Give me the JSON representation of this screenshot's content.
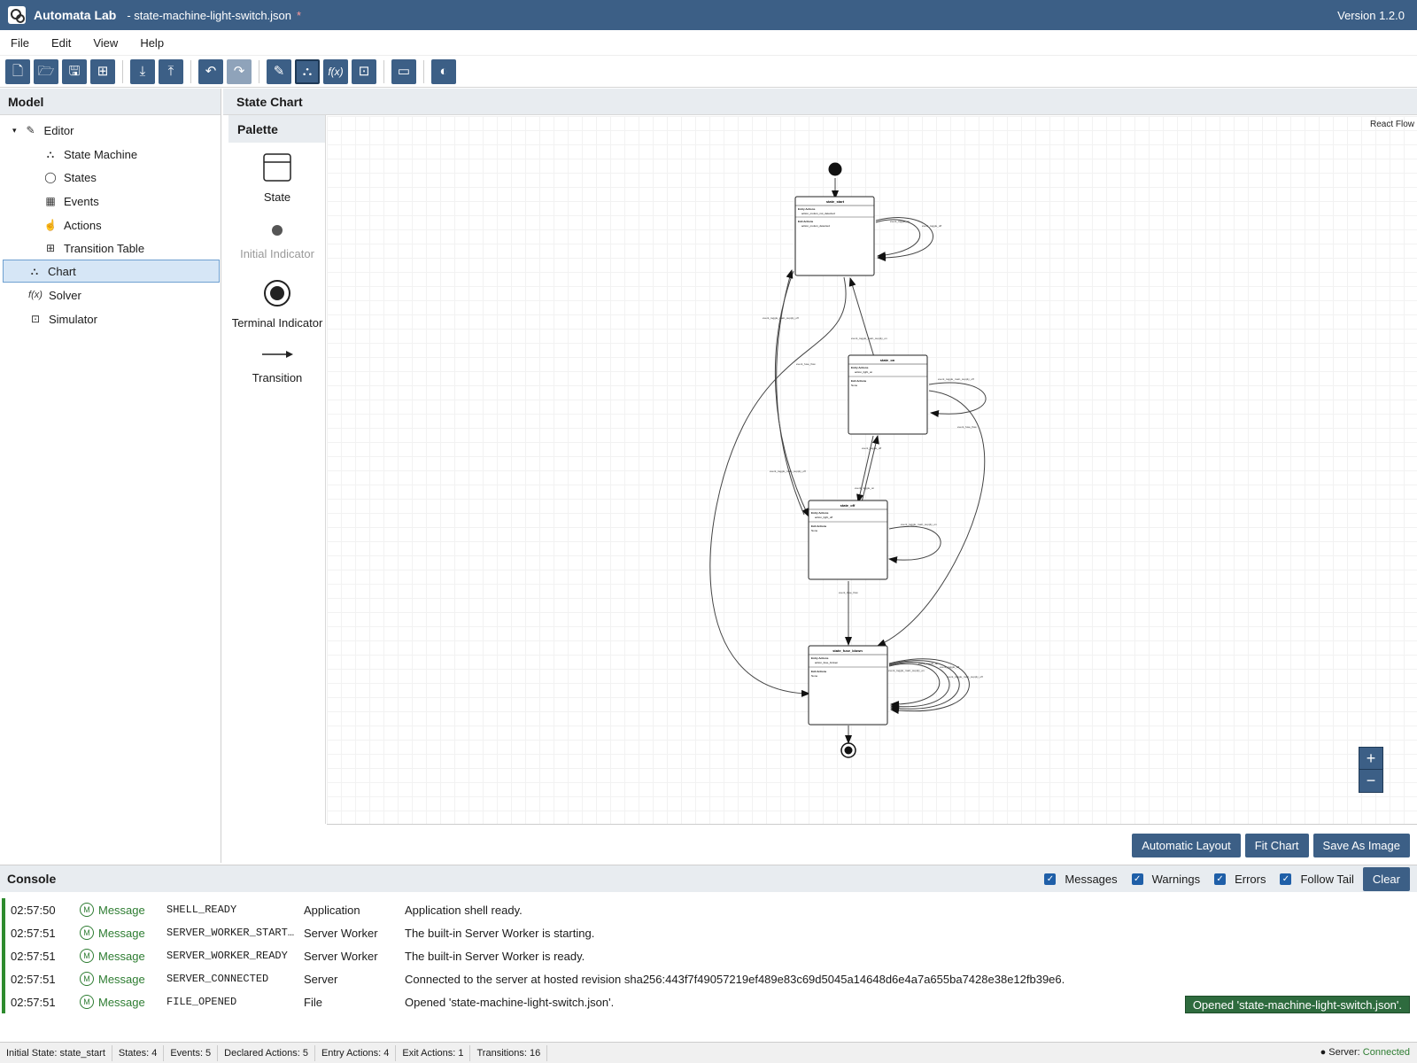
{
  "titlebar": {
    "app_name": "Automata Lab",
    "file_name": "- state-machine-light-switch.json",
    "dirty_marker": "*",
    "version": "Version 1.2.0"
  },
  "menu": {
    "file": "File",
    "edit": "Edit",
    "view": "View",
    "help": "Help"
  },
  "toolbar": {
    "icons": [
      "new-file-icon",
      "open-folder-icon",
      "save-icon",
      "save-as-icon",
      "import-icon",
      "export-icon",
      "undo-icon",
      "redo-icon",
      "editor-icon",
      "chart-icon",
      "solver-icon",
      "simulator-icon",
      "window-icon",
      "theme-toggle-icon"
    ]
  },
  "model": {
    "title": "Model",
    "items": [
      {
        "label": "Editor",
        "icon": "editor-icon"
      },
      {
        "label": "State Machine",
        "icon": "state-machine-icon"
      },
      {
        "label": "States",
        "icon": "circle-icon"
      },
      {
        "label": "Events",
        "icon": "calendar-icon"
      },
      {
        "label": "Actions",
        "icon": "hand-pointer-icon"
      },
      {
        "label": "Transition Table",
        "icon": "table-icon"
      },
      {
        "label": "Chart",
        "icon": "chart-icon"
      },
      {
        "label": "Solver",
        "icon": "function-icon"
      },
      {
        "label": "Simulator",
        "icon": "simulator-icon"
      }
    ]
  },
  "chart": {
    "title": "State Chart",
    "attribution": "React Flow",
    "palette": {
      "title": "Palette",
      "items": [
        {
          "label": "State"
        },
        {
          "label": "Initial Indicator"
        },
        {
          "label": "Terminal Indicator"
        },
        {
          "label": "Transition"
        }
      ]
    },
    "states": [
      {
        "name": "state_start",
        "entry_title": "Entry Actions",
        "entry": "action_motion_not_detected",
        "exit_title": "Exit Actions",
        "exit": "action_motion_detected"
      },
      {
        "name": "state_on",
        "entry_title": "Entry Actions",
        "entry": "action_light_on",
        "exit_title": "Exit Actions",
        "exit": "None"
      },
      {
        "name": "state_off",
        "entry_title": "Entry Actions",
        "entry": "action_light_off",
        "exit_title": "Exit Actions",
        "exit": "None"
      },
      {
        "name": "state_fuse_blown",
        "entry_title": "Entry Actions",
        "entry": "action_fuse_broken",
        "exit_title": "Exit Actions",
        "exit": "None"
      }
    ],
    "edge_labels": [
      "event_toggle_on",
      "event_toggle_off",
      "event_toggle_main_supply_on",
      "event_toggle_main_supply_off",
      "event_fuse_flow",
      "event_toggle_main_supply_off",
      "event_fuse_flow",
      "event_toggle_main_supply_off",
      "event_toggle_off",
      "event_toggle_on",
      "event_toggle_main_supply_on",
      "event_fuse_flow",
      "event_toggle_on",
      "event_toggle_off",
      "event_toggle_main_supply_on",
      "event_toggle_main_supply_off"
    ],
    "zoom": {
      "in": "+",
      "out": "−"
    },
    "buttons": {
      "layout": "Automatic Layout",
      "fit": "Fit Chart",
      "save": "Save As Image"
    }
  },
  "console": {
    "title": "Console",
    "filters": [
      {
        "label": "Messages",
        "checked": true
      },
      {
        "label": "Warnings",
        "checked": true
      },
      {
        "label": "Errors",
        "checked": true
      },
      {
        "label": "Follow Tail",
        "checked": true
      }
    ],
    "clear": "Clear",
    "level_badge": "M",
    "rows": [
      {
        "time": "02:57:50",
        "level": "Message",
        "code": "SHELL_READY",
        "source": "Application",
        "message": "Application shell ready."
      },
      {
        "time": "02:57:51",
        "level": "Message",
        "code": "SERVER_WORKER_START…",
        "source": "Server Worker",
        "message": "The built-in Server Worker is starting."
      },
      {
        "time": "02:57:51",
        "level": "Message",
        "code": "SERVER_WORKER_READY",
        "source": "Server Worker",
        "message": "The built-in Server Worker is ready."
      },
      {
        "time": "02:57:51",
        "level": "Message",
        "code": "SERVER_CONNECTED",
        "source": "Server",
        "message": "Connected to the server at hosted revision sha256:443f7f49057219ef489e83c69d5045a14648d6e4a7a655ba7428e38e12fb39e6."
      },
      {
        "time": "02:57:51",
        "level": "Message",
        "code": "FILE_OPENED",
        "source": "File",
        "message": "Opened 'state-machine-light-switch.json'."
      }
    ],
    "toast": "Opened 'state-machine-light-switch.json'."
  },
  "status": {
    "initial_state": "Initial State: state_start",
    "states": "States: 4",
    "events": "Events: 5",
    "declared_actions": "Declared Actions: 5",
    "entry_actions": "Entry Actions: 4",
    "exit_actions": "Exit Actions: 1",
    "transitions": "Transitions: 16",
    "server_label": "● Server:",
    "server_value": "Connected"
  },
  "colors": {
    "primary": "#3c5f86",
    "connected": "#2e7d32",
    "toast": "#2e6b3e"
  }
}
